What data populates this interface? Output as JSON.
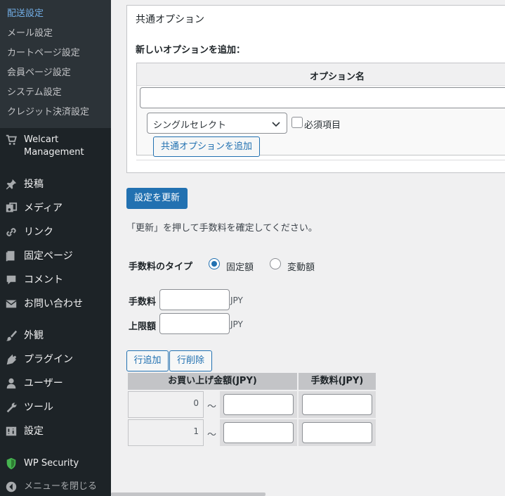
{
  "sidebar": {
    "submenu": [
      {
        "label": "配送設定",
        "current": true
      },
      {
        "label": "メール設定"
      },
      {
        "label": "カートページ設定"
      },
      {
        "label": "会員ページ設定"
      },
      {
        "label": "システム設定"
      },
      {
        "label": "クレジット決済設定"
      }
    ],
    "welcart_label": "Welcart Management",
    "menu": [
      {
        "label": "投稿",
        "icon": "pin-icon"
      },
      {
        "label": "メディア",
        "icon": "media-icon"
      },
      {
        "label": "リンク",
        "icon": "link-icon"
      },
      {
        "label": "固定ページ",
        "icon": "page-icon"
      },
      {
        "label": "コメント",
        "icon": "comment-icon"
      },
      {
        "label": "お問い合わせ",
        "icon": "mail-icon"
      },
      {
        "label": "外観",
        "icon": "brush-icon"
      },
      {
        "label": "プラグイン",
        "icon": "plugin-icon"
      },
      {
        "label": "ユーザー",
        "icon": "user-icon"
      },
      {
        "label": "ツール",
        "icon": "wrench-icon"
      },
      {
        "label": "設定",
        "icon": "settings-icon"
      },
      {
        "label": "WP Security",
        "icon": "shield-icon"
      },
      {
        "label": "メニューを閉じる",
        "icon": "collapse-icon"
      }
    ]
  },
  "options_box": {
    "title": "共通オプション",
    "add_heading": "新しいオプションを追加：",
    "column_header": "オプション名",
    "name_value": "",
    "select_value": "シングルセレクト",
    "required_label": "必須項目",
    "add_button": "共通オプションを追加"
  },
  "update_button": "設定を更新",
  "update_note": "「更新」を押して手数料を確定してください。",
  "fee_type": {
    "label": "手数料のタイプ",
    "options": [
      {
        "label": "固定額",
        "checked": true
      },
      {
        "label": "変動額",
        "checked": false
      }
    ]
  },
  "fee": {
    "label": "手数料",
    "value": "",
    "unit": "JPY"
  },
  "limit": {
    "label": "上限額",
    "value": "",
    "unit": "JPY"
  },
  "row_buttons": {
    "add": "行追加",
    "delete": "行削除"
  },
  "fee_table": {
    "headers": [
      "お買い上げ金額(JPY)",
      "手数料(JPY)"
    ],
    "rows": [
      {
        "from": "0",
        "sep": "～",
        "to": "",
        "fee": ""
      },
      {
        "from": "1",
        "sep": "～",
        "to": "",
        "fee": ""
      }
    ]
  }
}
